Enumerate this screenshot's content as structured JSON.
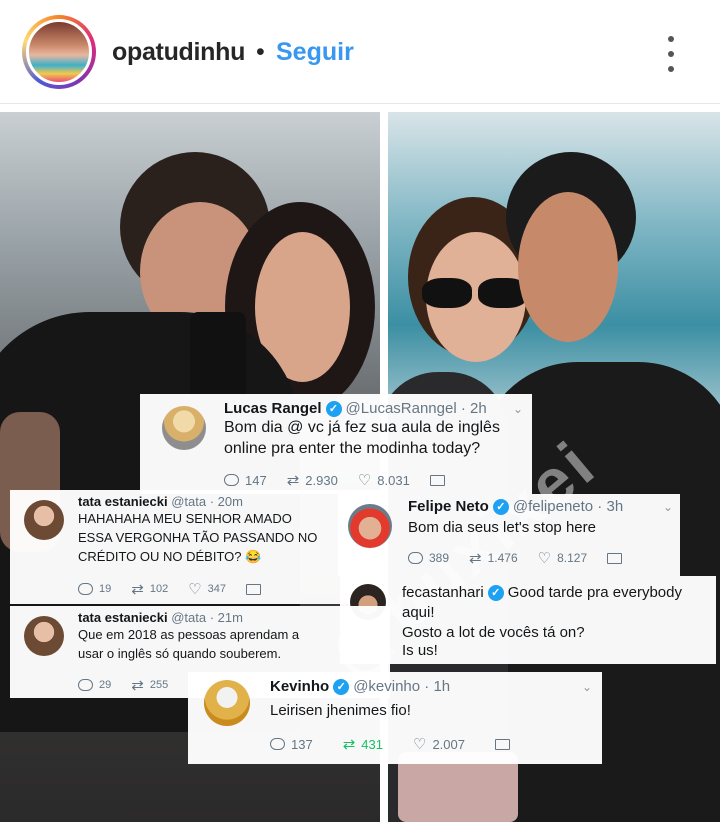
{
  "post": {
    "username": "opatudinhu",
    "separator": "•",
    "follow_label": "Seguir",
    "more_icon": "more-vertical-icon"
  },
  "watermark": "@buxixei",
  "tweets": [
    {
      "name": "Lucas Rangel",
      "handle": "@LucasRanngel · 2h",
      "lines": [
        "Bom dia @ vc já fez sua aula de inglês",
        "online pra enter the modinha today?"
      ],
      "replies": "147",
      "retweets": "2.930",
      "likes": "8.031"
    },
    {
      "name": "tata estaniecki",
      "handle": "@tata · 20m",
      "lines": [
        "HAHAHAHA MEU SENHOR AMADO",
        "ESSA VERGONHA TÃO PASSANDO NO",
        "CRÉDITO OU NO DÉBITO? 😂"
      ],
      "replies": "19",
      "retweets": "102",
      "likes": "347"
    },
    {
      "name": "Felipe Neto",
      "handle": "@felipeneto · 3h",
      "lines": [
        "Bom dia seus let's stop here"
      ],
      "replies": "389",
      "retweets": "1.476",
      "likes": "8.127"
    },
    {
      "name": "fecastanhari",
      "handle": "",
      "lines": [
        "Good tarde pra everybody",
        "aqui!",
        "Gosto a lot de vocês tá on?",
        "Is us!"
      ]
    },
    {
      "name": "tata estaniecki",
      "handle": "@tata · 21m",
      "lines": [
        "Que em 2018 as pessoas aprendam a",
        "usar o inglês só quando souberem."
      ],
      "replies": "29",
      "retweets": "255"
    },
    {
      "name": "Kevinho",
      "handle": "@kevinho · 1h",
      "lines": [
        "Leirisen jhenimes fio!"
      ],
      "replies": "137",
      "retweets": "431",
      "likes": "2.007"
    }
  ]
}
